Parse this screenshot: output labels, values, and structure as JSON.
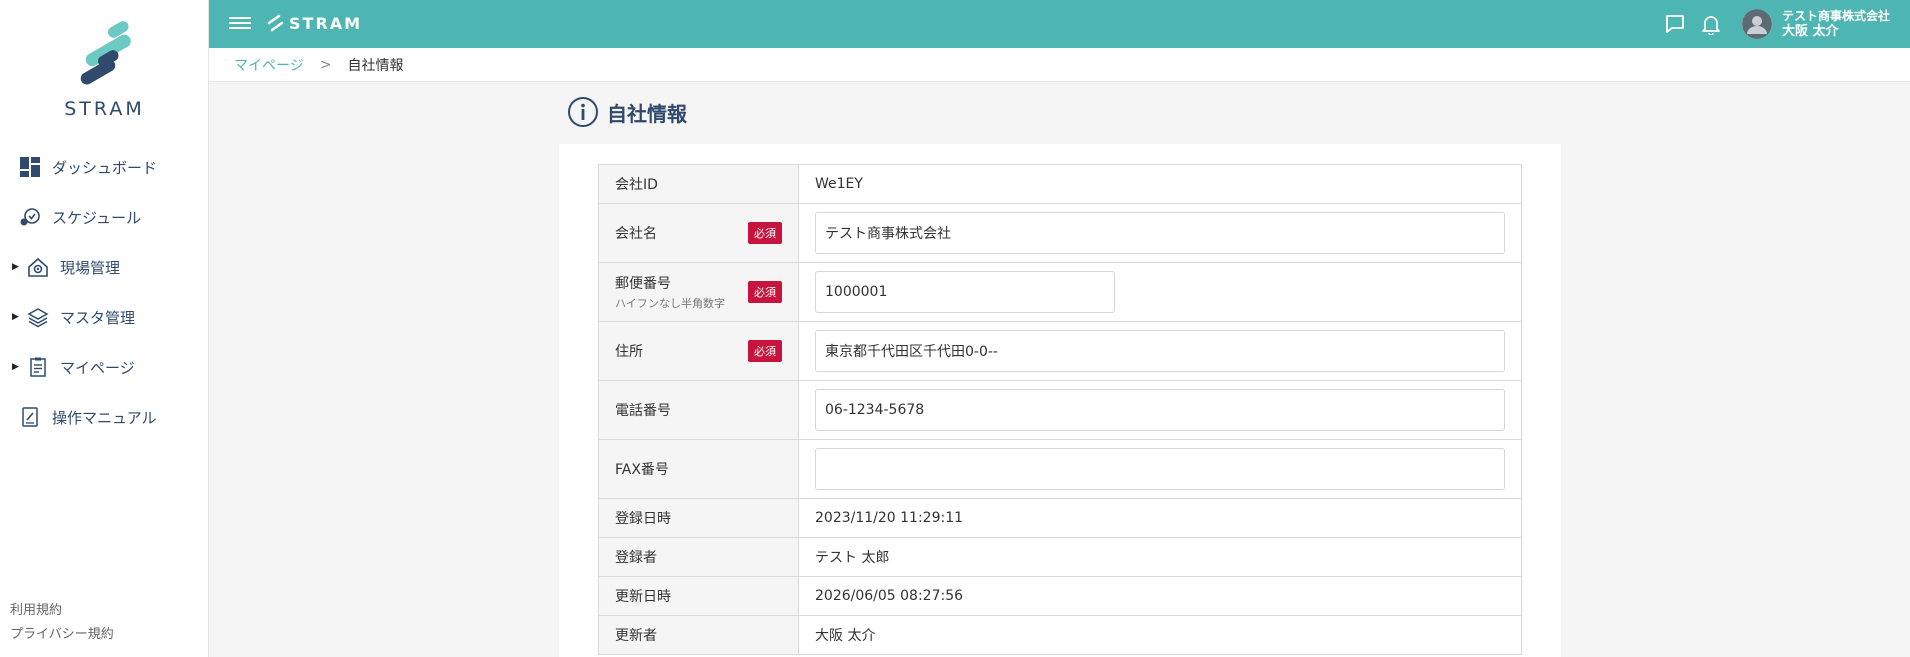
{
  "app": {
    "logo_text": "STRAM",
    "brand_text": "STRAM"
  },
  "sidebar": {
    "items": [
      {
        "label": "ダッシュボード",
        "icon": "dashboard-icon"
      },
      {
        "label": "スケジュール",
        "icon": "schedule-icon"
      },
      {
        "label": "現場管理",
        "icon": "site-management-icon"
      },
      {
        "label": "マスタ管理",
        "icon": "layers-icon"
      },
      {
        "label": "マイページ",
        "icon": "document-icon"
      },
      {
        "label": "操作マニュアル",
        "icon": "manual-icon"
      }
    ],
    "footer": {
      "terms": "利用規約",
      "privacy": "プライバシー規約"
    }
  },
  "header": {
    "company": "テスト商事株式会社",
    "user": "大阪 太介"
  },
  "breadcrumb": {
    "parent": "マイページ",
    "separator": ">",
    "current": "自社情報"
  },
  "page": {
    "title": "自社情報"
  },
  "form": {
    "required_badge": "必須",
    "company_id": {
      "label": "会社ID",
      "value": "We1EY"
    },
    "company_name": {
      "label": "会社名",
      "value": "テスト商事株式会社"
    },
    "postal_code": {
      "label": "郵便番号",
      "hint": "ハイフンなし半角数字",
      "value": "1000001"
    },
    "address": {
      "label": "住所",
      "value": "東京都千代田区千代田0-0--"
    },
    "phone": {
      "label": "電話番号",
      "value": "06-1234-5678"
    },
    "fax": {
      "label": "FAX番号",
      "value": ""
    },
    "registered_at": {
      "label": "登録日時",
      "value": "2023/11/20 11:29:11"
    },
    "registered_by": {
      "label": "登録者",
      "value": "テスト 太郎"
    },
    "updated_at": {
      "label": "更新日時",
      "value": "2026/06/05 08:27:56"
    },
    "updated_by": {
      "label": "更新者",
      "value": "大阪 太介"
    }
  },
  "colors": {
    "accent": "#4db6b2",
    "navy": "#2f4a6d",
    "required": "#c8143c"
  }
}
